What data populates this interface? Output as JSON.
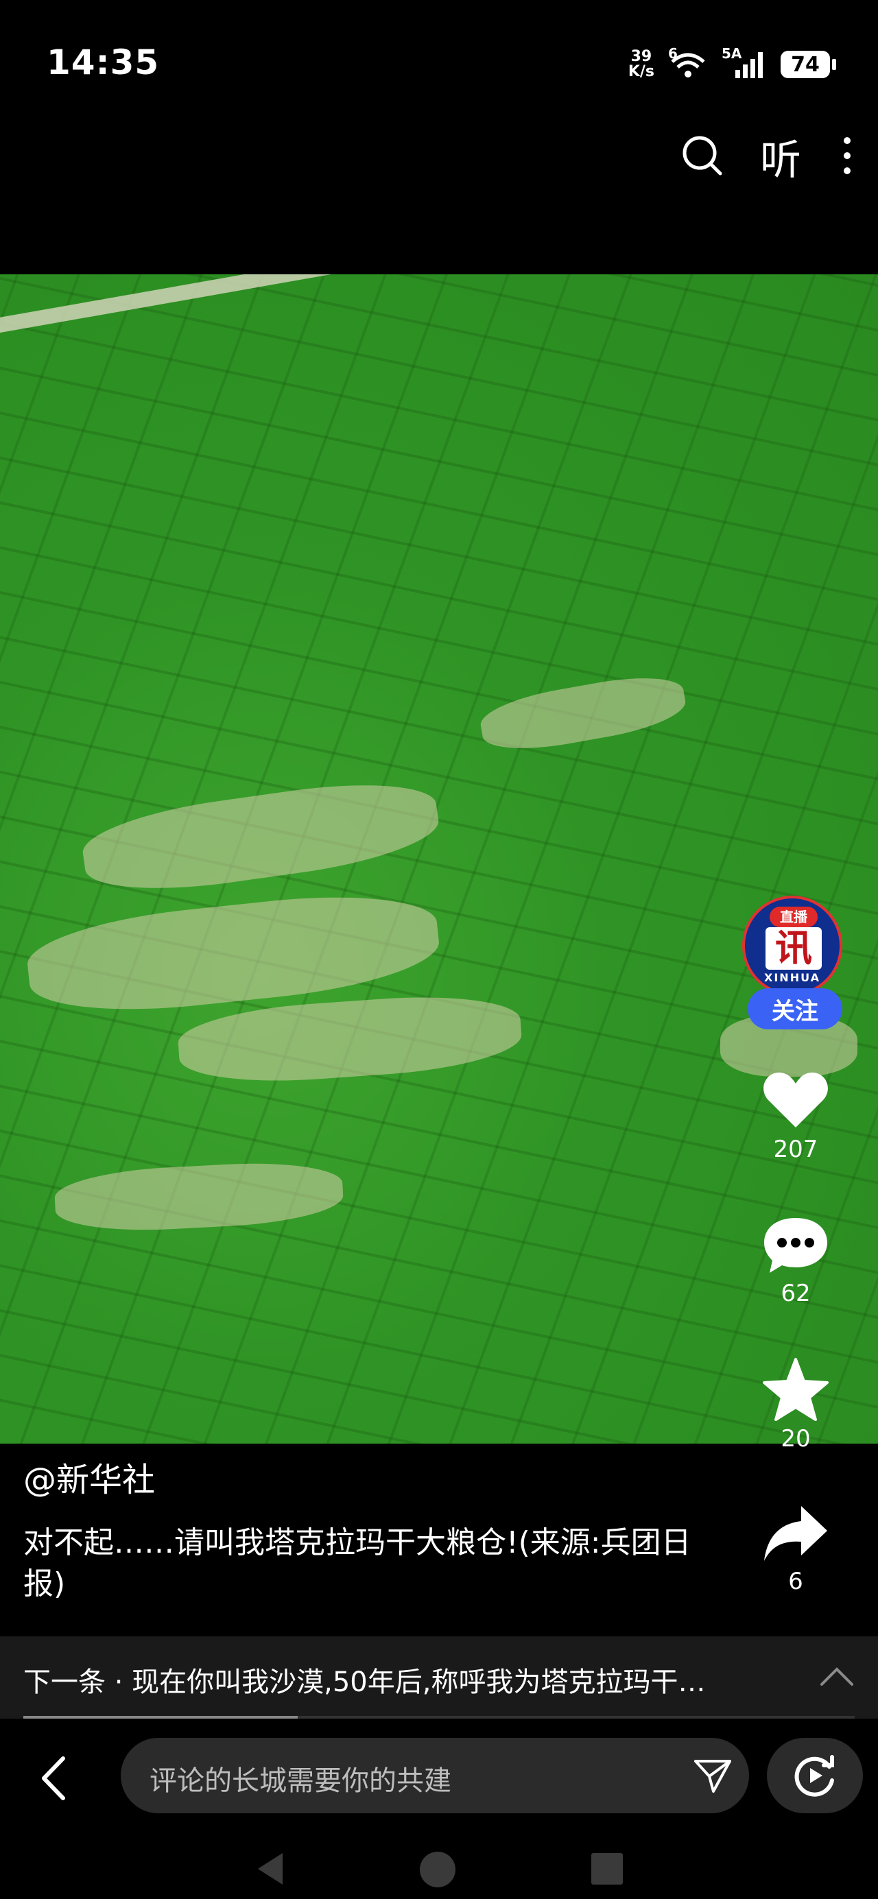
{
  "status": {
    "time": "14:35",
    "speed_value": "39",
    "speed_unit": "K/s",
    "wifi_label": "6",
    "signal_label": "5A",
    "battery": "74"
  },
  "topbar": {
    "listen_label": "听"
  },
  "author": {
    "live_badge": "直播",
    "logo_text": "讯",
    "logo_word": "XINHUA",
    "follow_label": "关注",
    "handle": "@新华社"
  },
  "stats": {
    "likes": "207",
    "comments": "62",
    "favorites": "20",
    "shares": "6"
  },
  "caption": {
    "text": "对不起……请叫我塔克拉玛干大粮仓!(来源:兵团日报)"
  },
  "next": {
    "text": "下一条 · 现在你叫我沙漠,50年后,称呼我为塔克拉玛干…",
    "progress": 0.33
  },
  "comment": {
    "placeholder": "评论的长城需要你的共建"
  },
  "colors": {
    "follow": "#3a63f6",
    "video_green": "#2f9425",
    "avatar_ring": "#e03333"
  }
}
